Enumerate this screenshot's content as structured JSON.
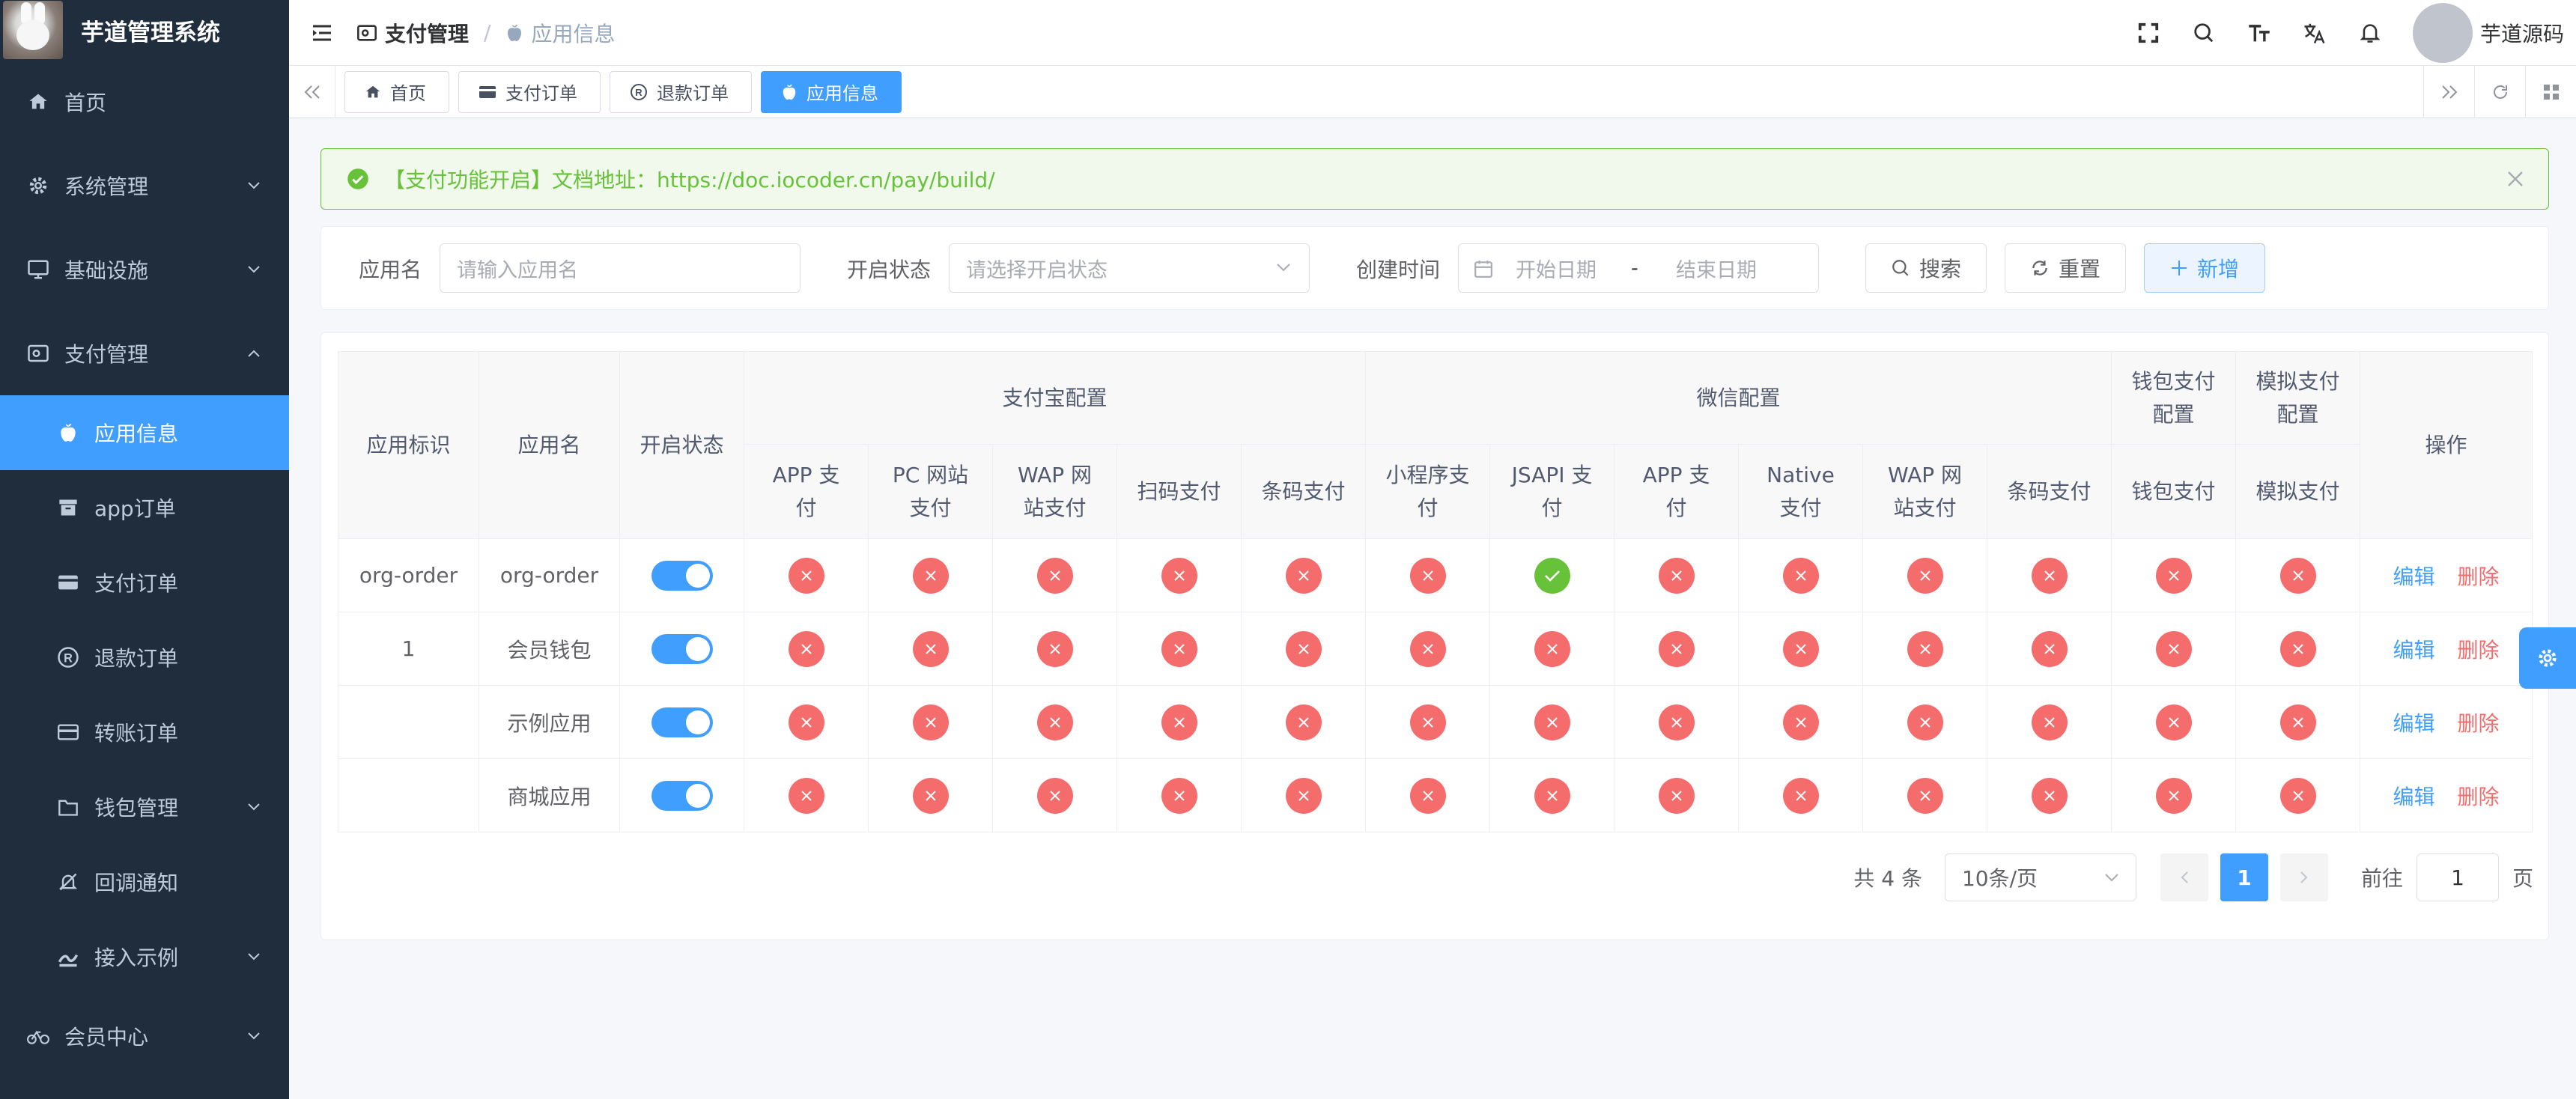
{
  "app": {
    "title": "芋道管理系统"
  },
  "colors": {
    "sidebar_bg": "#1f2d3d",
    "primary": "#409eff",
    "success": "#67c23a",
    "danger": "#f56c6c"
  },
  "sidebar": {
    "items": [
      {
        "label": "首页",
        "icon": "home-icon"
      },
      {
        "label": "系统管理",
        "icon": "gear-icon"
      },
      {
        "label": "基础设施",
        "icon": "monitor-icon"
      },
      {
        "label": "支付管理",
        "icon": "pay-icon",
        "expanded": true
      }
    ],
    "pay_children": [
      {
        "label": "应用信息",
        "icon": "apple-icon",
        "active": true
      },
      {
        "label": "app订单",
        "icon": "archive-icon"
      },
      {
        "label": "支付订单",
        "icon": "card-icon"
      },
      {
        "label": "退款订单",
        "icon": "registered-icon"
      },
      {
        "label": "转账订单",
        "icon": "transfer-icon"
      },
      {
        "label": "钱包管理",
        "icon": "folder-icon"
      },
      {
        "label": "回调通知",
        "icon": "bell-off-icon"
      },
      {
        "label": "接入示例",
        "icon": "example-icon"
      }
    ],
    "member": {
      "label": "会员中心",
      "icon": "bike-icon"
    }
  },
  "navbar": {
    "breadcrumb": [
      {
        "label": "支付管理"
      },
      {
        "label": "应用信息"
      }
    ],
    "separator": "/",
    "username": "芋道源码"
  },
  "tags": [
    {
      "label": "首页",
      "icon": "home-icon"
    },
    {
      "label": "支付订单",
      "icon": "card-icon"
    },
    {
      "label": "退款订单",
      "icon": "registered-icon"
    },
    {
      "label": "应用信息",
      "icon": "apple-icon",
      "active": true
    }
  ],
  "alert": {
    "text": "【支付功能开启】文档地址：https://doc.iocoder.cn/pay/build/"
  },
  "search": {
    "name_label": "应用名",
    "name_placeholder": "请输入应用名",
    "status_label": "开启状态",
    "status_placeholder": "请选择开启状态",
    "time_label": "创建时间",
    "start_placeholder": "开始日期",
    "range_sep": "-",
    "end_placeholder": "结束日期",
    "search_btn": "搜索",
    "reset_btn": "重置",
    "add_btn": "新增"
  },
  "table": {
    "headers": {
      "app_id": "应用标识",
      "app_name": "应用名",
      "status": "开启状态",
      "alipay_group": "支付宝配置",
      "wechat_group": "微信配置",
      "wallet_group": "钱包支付配置",
      "mock_group": "模拟支付配置",
      "ops": "操作",
      "alipay": [
        "APP 支付",
        "PC 网站支付",
        "WAP 网站支付",
        "扫码支付",
        "条码支付"
      ],
      "wechat": [
        "小程序支付",
        "JSAPI 支付",
        "APP 支付",
        "Native 支付",
        "WAP 网站支付",
        "条码支付"
      ],
      "wallet": "钱包支付",
      "mock": "模拟支付"
    },
    "rows": [
      {
        "app_id": "org-order",
        "app_name": "org-order",
        "enabled": true,
        "channels": [
          false,
          false,
          false,
          false,
          false,
          false,
          true,
          false,
          false,
          false,
          false,
          false,
          false
        ]
      },
      {
        "app_id": "1",
        "app_name": "会员钱包",
        "enabled": true,
        "channels": [
          false,
          false,
          false,
          false,
          false,
          false,
          false,
          false,
          false,
          false,
          false,
          false,
          false
        ]
      },
      {
        "app_id": "",
        "app_name": "示例应用",
        "enabled": true,
        "channels": [
          false,
          false,
          false,
          false,
          false,
          false,
          false,
          false,
          false,
          false,
          false,
          false,
          false
        ]
      },
      {
        "app_id": "",
        "app_name": "商城应用",
        "enabled": true,
        "channels": [
          false,
          false,
          false,
          false,
          false,
          false,
          false,
          false,
          false,
          false,
          false,
          false,
          false
        ]
      }
    ],
    "edit_label": "编辑",
    "delete_label": "删除"
  },
  "pagination": {
    "total_text": "共 4 条",
    "page_size": "10条/页",
    "current_page": "1",
    "goto_label": "前往",
    "goto_value": "1",
    "page_suffix": "页"
  }
}
